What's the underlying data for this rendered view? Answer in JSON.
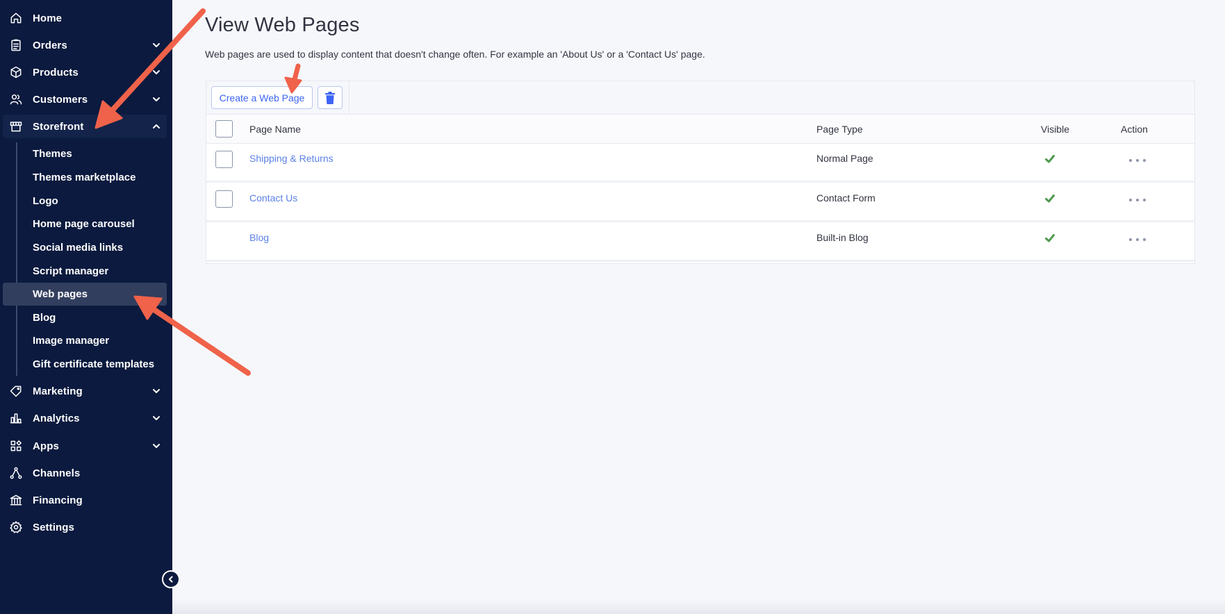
{
  "sidebar": {
    "items": [
      {
        "label": "Home"
      },
      {
        "label": "Orders"
      },
      {
        "label": "Products"
      },
      {
        "label": "Customers"
      },
      {
        "label": "Storefront"
      },
      {
        "label": "Marketing"
      },
      {
        "label": "Analytics"
      },
      {
        "label": "Apps"
      },
      {
        "label": "Channels"
      },
      {
        "label": "Financing"
      },
      {
        "label": "Settings"
      }
    ],
    "storefront_sub": [
      {
        "label": "Themes"
      },
      {
        "label": "Themes marketplace"
      },
      {
        "label": "Logo"
      },
      {
        "label": "Home page carousel"
      },
      {
        "label": "Social media links"
      },
      {
        "label": "Script manager"
      },
      {
        "label": "Web pages"
      },
      {
        "label": "Blog"
      },
      {
        "label": "Image manager"
      },
      {
        "label": "Gift certificate templates"
      }
    ]
  },
  "main": {
    "title": "View Web Pages",
    "description": "Web pages are used to display content that doesn't change often. For example an 'About Us' or a 'Contact Us' page.",
    "create_label": "Create a Web Page",
    "columns": {
      "name": "Page Name",
      "type": "Page Type",
      "visible": "Visible",
      "action": "Action"
    },
    "rows": [
      {
        "name": "Shipping & Returns",
        "type": "Normal Page"
      },
      {
        "name": "Contact Us",
        "type": "Contact Form"
      },
      {
        "name": "Blog",
        "type": "Built-in Blog"
      }
    ]
  },
  "colors": {
    "sidebar_bg": "#0b1a3e",
    "accent": "#3c64f4",
    "link": "#5b80e6",
    "visible_check": "#4e9a4e",
    "annotation_arrow": "#f0624a"
  }
}
